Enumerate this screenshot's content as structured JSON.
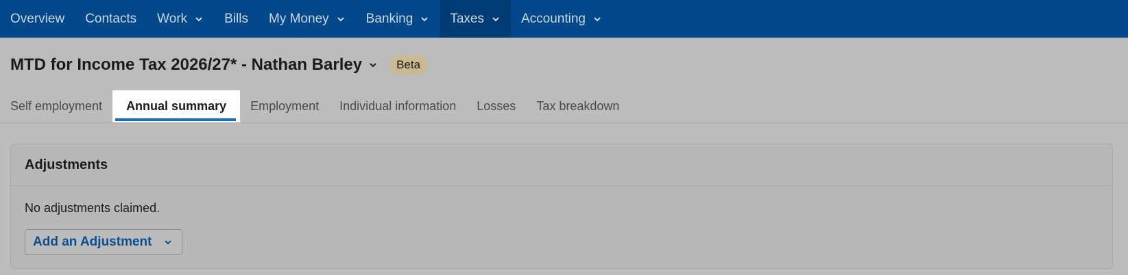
{
  "nav": {
    "items": [
      {
        "label": "Overview",
        "dropdown": false,
        "active": false
      },
      {
        "label": "Contacts",
        "dropdown": false,
        "active": false
      },
      {
        "label": "Work",
        "dropdown": true,
        "active": false
      },
      {
        "label": "Bills",
        "dropdown": false,
        "active": false
      },
      {
        "label": "My Money",
        "dropdown": true,
        "active": false
      },
      {
        "label": "Banking",
        "dropdown": true,
        "active": false
      },
      {
        "label": "Taxes",
        "dropdown": true,
        "active": true
      },
      {
        "label": "Accounting",
        "dropdown": true,
        "active": false
      }
    ]
  },
  "page": {
    "title": "MTD for Income Tax 2026/27* - Nathan Barley",
    "badge": "Beta"
  },
  "tabs": [
    {
      "label": "Self employment",
      "active": false
    },
    {
      "label": "Annual summary",
      "active": true
    },
    {
      "label": "Employment",
      "active": false
    },
    {
      "label": "Individual information",
      "active": false
    },
    {
      "label": "Losses",
      "active": false
    },
    {
      "label": "Tax breakdown",
      "active": false
    }
  ],
  "adjustments": {
    "title": "Adjustments",
    "empty_text": "No adjustments claimed.",
    "add_button_label": "Add an Adjustment"
  },
  "colors": {
    "nav_bg": "#00488a",
    "nav_active_bg": "#003c74",
    "accent": "#1a6fc0",
    "link": "#0a4e93",
    "badge_bg": "#cbb98f"
  }
}
